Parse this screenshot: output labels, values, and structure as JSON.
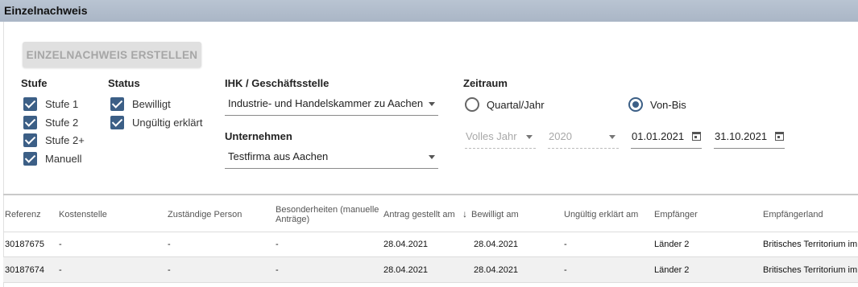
{
  "header": {
    "title": "Einzelnachweis"
  },
  "toolbar": {
    "create_label": "EINZELNACHWEIS ERSTELLEN"
  },
  "stufe": {
    "label": "Stufe",
    "options": [
      {
        "label": "Stufe 1",
        "checked": true
      },
      {
        "label": "Stufe 2",
        "checked": true
      },
      {
        "label": "Stufe 2+",
        "checked": true
      },
      {
        "label": "Manuell",
        "checked": true
      }
    ]
  },
  "status": {
    "label": "Status",
    "options": [
      {
        "label": "Bewilligt",
        "checked": true
      },
      {
        "label": "Ungültig erklärt",
        "checked": true
      }
    ]
  },
  "ihk": {
    "label": "IHK / Geschäftsstelle",
    "value": "Industrie- und Handelskammer zu Aachen"
  },
  "unternehmen": {
    "label": "Unternehmen",
    "value": "Testfirma aus Aachen"
  },
  "zeitraum": {
    "label": "Zeitraum",
    "radio_quartal": "Quartal/Jahr",
    "radio_vonbis": "Von-Bis",
    "selected": "Von-Bis",
    "period_value": "Volles Jahr",
    "year_value": "2020",
    "from_date": "01.01.2021",
    "to_date": "31.10.2021"
  },
  "table": {
    "columns": {
      "referenz": "Referenz",
      "kostenstelle": "Kostenstelle",
      "person": "Zuständige Person",
      "besonderheiten": "Besonderheiten (manuelle Anträge)",
      "antrag": "Antrag gestellt am",
      "bewilligt": "Bewilligt am",
      "ungueltig": "Ungültig erklärt am",
      "empfaenger": "Empfänger",
      "empfaengerland": "Empfängerland"
    },
    "sorted_column": "bewilligt",
    "sort_direction": "descending",
    "rows": [
      {
        "referenz": "30187675",
        "kostenstelle": "-",
        "person": "-",
        "besonderheiten": "-",
        "antrag": "28.04.2021",
        "bewilligt": "28.04.2021",
        "ungueltig": "-",
        "empfaenger": "Länder 2",
        "empfaengerland": "Britisches Territorium im Indischen Ozean"
      },
      {
        "referenz": "30187674",
        "kostenstelle": "-",
        "person": "-",
        "besonderheiten": "-",
        "antrag": "28.04.2021",
        "bewilligt": "28.04.2021",
        "ungueltig": "-",
        "empfaenger": "Länder 2",
        "empfaengerland": "Britisches Territorium im Indischen Ozean"
      }
    ]
  },
  "colors": {
    "accent": "#3c5f86",
    "header_bg": "#b1bccb",
    "row_alt": "#f1f1f1"
  }
}
